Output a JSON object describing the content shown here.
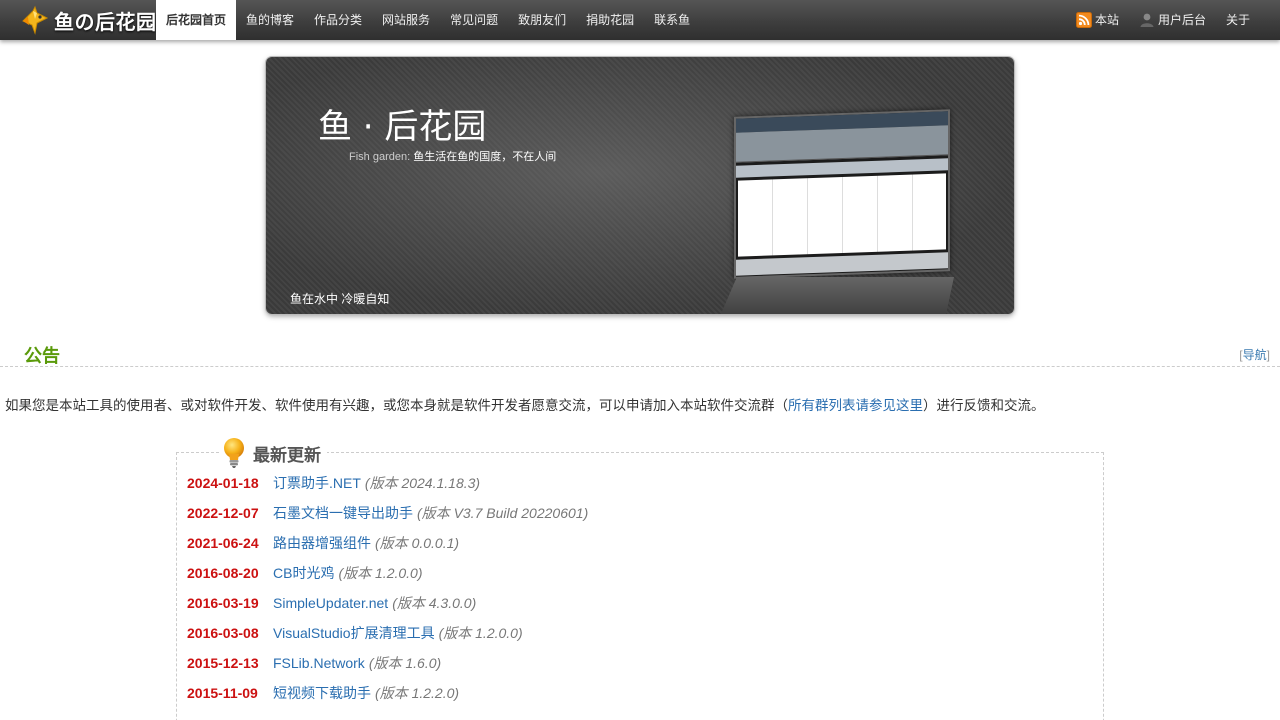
{
  "brand": {
    "name": "鱼の后花园"
  },
  "nav": {
    "items": [
      {
        "label": "后花园首页",
        "active": true
      },
      {
        "label": "鱼的博客"
      },
      {
        "label": "作品分类"
      },
      {
        "label": "网站服务"
      },
      {
        "label": "常见问题"
      },
      {
        "label": "致朋友们"
      },
      {
        "label": "捐助花园"
      },
      {
        "label": "联系鱼"
      }
    ],
    "right": [
      {
        "label": "本站",
        "icon": "rss-icon"
      },
      {
        "label": "用户后台",
        "icon": "user-icon"
      },
      {
        "label": "关于"
      }
    ]
  },
  "banner": {
    "title": "鱼 · 后花园",
    "subtitle_prefix": "Fish garden:",
    "subtitle": "鱼生活在鱼的国度，不在人间",
    "motto": "鱼在水中 冷暖自知"
  },
  "notice": {
    "title": "公告",
    "nav_link": "导航",
    "text_before": "如果您是本站工具的使用者、或对软件开发、软件使用有兴趣，或您本身就是软件开发者愿意交流，可以申请加入本站软件交流群（",
    "link": "所有群列表请参见这里",
    "text_after": "）进行反馈和交流。"
  },
  "updates": {
    "title": "最新更新",
    "version_prefix": "版本",
    "items": [
      {
        "date": "2024-01-18",
        "name": "订票助手.NET",
        "version": "2024.1.18.3"
      },
      {
        "date": "2022-12-07",
        "name": "石墨文档一键导出助手",
        "version": "V3.7 Build 20220601"
      },
      {
        "date": "2021-06-24",
        "name": "路由器增强组件",
        "version": "0.0.0.1"
      },
      {
        "date": "2016-08-20",
        "name": "CB时光鸡",
        "version": "1.2.0.0"
      },
      {
        "date": "2016-03-19",
        "name": "SimpleUpdater.net",
        "version": "4.3.0.0"
      },
      {
        "date": "2016-03-08",
        "name": "VisualStudio扩展清理工具",
        "version": "1.2.0.0"
      },
      {
        "date": "2015-12-13",
        "name": "FSLib.Network",
        "version": "1.6.0"
      },
      {
        "date": "2015-11-09",
        "name": "短视频下载助手",
        "version": "1.2.2.0"
      }
    ]
  }
}
